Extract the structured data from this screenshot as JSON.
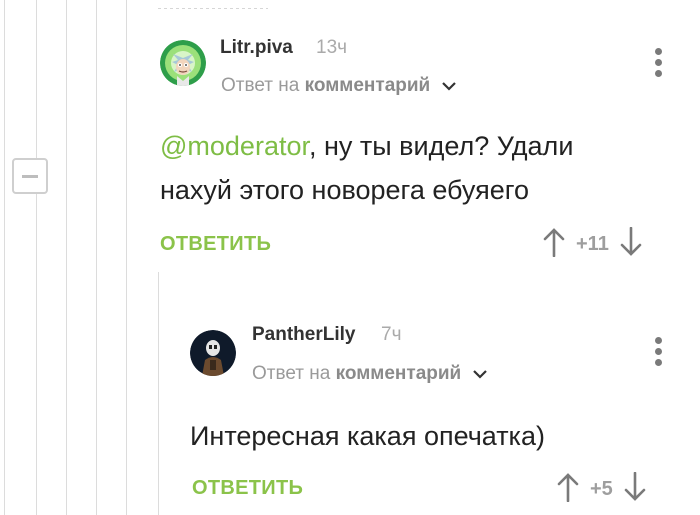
{
  "colors": {
    "accent": "#8bc34a",
    "mention": "#7ebd45",
    "muted": "#9a9a9a"
  },
  "comments": [
    {
      "username": "Litr.piva",
      "time": "13ч",
      "reply_prefix": "Ответ на",
      "reply_target": "комментарий",
      "mention": "@moderator",
      "text_line1": ", ну ты видел? Удали",
      "text_line2": "нахуй этого новорега ебуяего",
      "reply_label": "ОТВЕТИТЬ",
      "score": "+11",
      "avatar_icon": "rick-avatar-icon"
    },
    {
      "username": "PantherLily",
      "time": "7ч",
      "reply_prefix": "Ответ на",
      "reply_target": "комментарий",
      "text_line1": "Интересная какая опечатка)",
      "reply_label": "ОТВЕТИТЬ",
      "score": "+5",
      "avatar_icon": "masked-figure-avatar-icon"
    }
  ]
}
